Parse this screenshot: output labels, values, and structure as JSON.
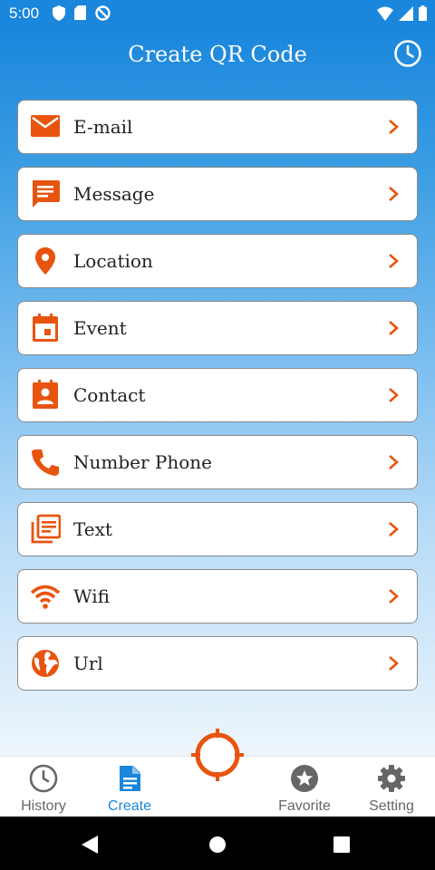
{
  "status": {
    "time": "5:00"
  },
  "header": {
    "title": "Create QR Code",
    "history_icon": "history-icon"
  },
  "items": [
    {
      "label": "E-mail",
      "icon": "email-icon"
    },
    {
      "label": "Message",
      "icon": "message-icon"
    },
    {
      "label": "Location",
      "icon": "location-pin-icon"
    },
    {
      "label": "Event",
      "icon": "calendar-icon"
    },
    {
      "label": "Contact",
      "icon": "contact-card-icon"
    },
    {
      "label": "Number Phone",
      "icon": "phone-icon"
    },
    {
      "label": "Text",
      "icon": "text-document-icon"
    },
    {
      "label": "Wifi",
      "icon": "wifi-icon"
    },
    {
      "label": "Url",
      "icon": "globe-icon"
    }
  ],
  "nav": {
    "history": "History",
    "create": "Create",
    "favorite": "Favorite",
    "setting": "Setting"
  },
  "colors": {
    "accent": "#e8540f",
    "primary": "#1a86dc",
    "inactive": "#666666"
  }
}
